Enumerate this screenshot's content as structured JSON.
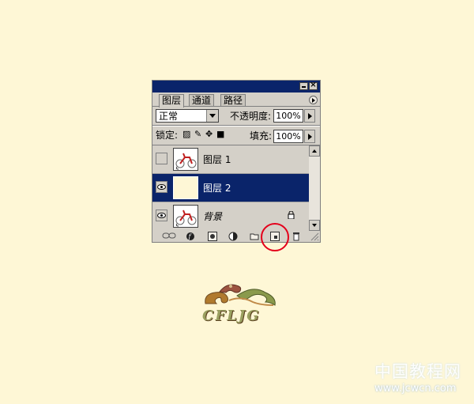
{
  "panel": {
    "titlebar": {
      "close_glyph": "×"
    },
    "tabs": [
      {
        "label": "图层",
        "active": true
      },
      {
        "label": "通道",
        "active": false
      },
      {
        "label": "路径",
        "active": false
      }
    ],
    "blend_mode": {
      "value": "正常"
    },
    "opacity": {
      "label": "不透明度:",
      "value": "100%"
    },
    "lock": {
      "label": "锁定:"
    },
    "fill": {
      "label": "填充:",
      "value": "100%"
    },
    "layers": [
      {
        "name": "图层 1",
        "visible": false,
        "selected": false,
        "italic": false,
        "locked": false
      },
      {
        "name": "图层 2",
        "visible": true,
        "selected": true,
        "italic": false,
        "locked": false
      },
      {
        "name": "背景",
        "visible": true,
        "selected": false,
        "italic": true,
        "locked": true
      }
    ]
  },
  "logo": {
    "text": "CFLJG"
  },
  "watermark": {
    "site_cn": "中国教程网",
    "url": "www.jcwcn.com"
  },
  "colors": {
    "background": "#fef7d6",
    "titlebar": "#0a246a",
    "selected_layer": "#0a246a",
    "highlight_circle": "#e4001b"
  }
}
